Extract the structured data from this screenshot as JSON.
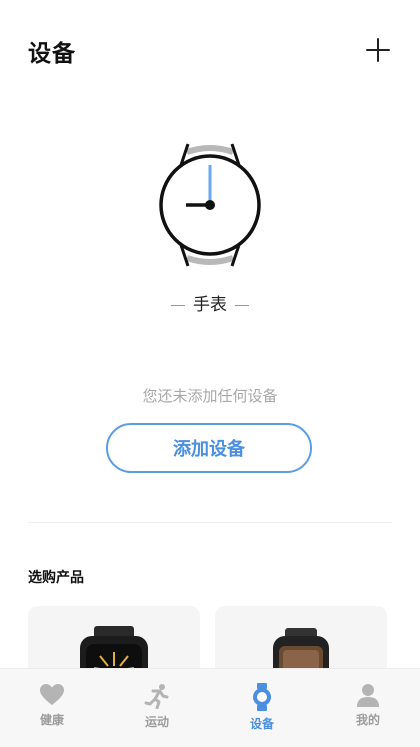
{
  "header": {
    "title": "设备",
    "add_icon": "plus-icon"
  },
  "illustration": {
    "icon": "watch-icon",
    "label": "手表"
  },
  "empty_state": {
    "hint": "您还未添加任何设备",
    "add_button_label": "添加设备"
  },
  "shop": {
    "title": "选购产品",
    "products": [
      {
        "icon": "smartwatch-product-image"
      },
      {
        "icon": "smartwatch-product-image"
      }
    ]
  },
  "tabbar": {
    "items": [
      {
        "label": "健康",
        "icon": "heart-icon"
      },
      {
        "label": "运动",
        "icon": "running-icon"
      },
      {
        "label": "设备",
        "icon": "watch-icon",
        "active": true
      },
      {
        "label": "我的",
        "icon": "person-icon"
      }
    ]
  },
  "colors": {
    "accent": "#4a8fe0",
    "inactive": "#9c9c9c",
    "hint": "#a8a8a8"
  }
}
